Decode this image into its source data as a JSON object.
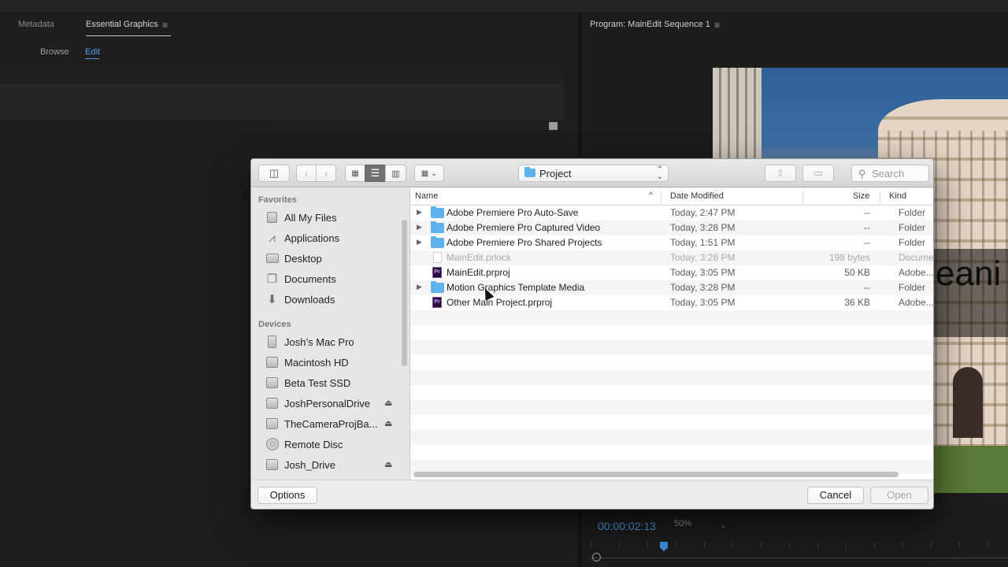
{
  "premiere": {
    "tabs": {
      "metadata": "Metadata",
      "essential_graphics": "Essential Graphics"
    },
    "subtabs": {
      "browse": "Browse",
      "edit": "Edit"
    },
    "program_title": "Program: MainEdit Sequence 1",
    "menu_icon": "≡",
    "timecode": "00:00:02:13",
    "zoom": "50%",
    "overlay_text": "eani"
  },
  "dialog": {
    "location": "Project",
    "search_placeholder": "Search",
    "sidebar": {
      "favorites_header": "Favorites",
      "favorites": [
        {
          "label": "All My Files",
          "icon": "all-files-icon"
        },
        {
          "label": "Applications",
          "icon": "applications-icon"
        },
        {
          "label": "Desktop",
          "icon": "desktop-icon"
        },
        {
          "label": "Documents",
          "icon": "documents-icon"
        },
        {
          "label": "Downloads",
          "icon": "downloads-icon"
        }
      ],
      "devices_header": "Devices",
      "devices": [
        {
          "label": "Josh’s Mac Pro",
          "icon": "computer-icon",
          "eject": false
        },
        {
          "label": "Macintosh HD",
          "icon": "disk-icon",
          "eject": false
        },
        {
          "label": "Beta Test SSD",
          "icon": "disk-icon",
          "eject": false
        },
        {
          "label": "JoshPersonalDrive",
          "icon": "disk-icon",
          "eject": true
        },
        {
          "label": "TheCameraProjBa...",
          "icon": "disk-icon",
          "eject": true
        },
        {
          "label": "Remote Disc",
          "icon": "disc-icon",
          "eject": false
        },
        {
          "label": "Josh_Drive",
          "icon": "disk-icon",
          "eject": true
        }
      ]
    },
    "columns": {
      "name": "Name",
      "date": "Date Modified",
      "size": "Size",
      "kind": "Kind"
    },
    "files": [
      {
        "name": "Adobe Premiere Pro Auto-Save",
        "date": "Today, 2:47 PM",
        "size": "--",
        "kind": "Folder",
        "type": "folder",
        "expandable": true
      },
      {
        "name": "Adobe Premiere Pro Captured Video",
        "date": "Today, 3:28 PM",
        "size": "--",
        "kind": "Folder",
        "type": "folder",
        "expandable": true
      },
      {
        "name": "Adobe Premiere Pro Shared Projects",
        "date": "Today, 1:51 PM",
        "size": "--",
        "kind": "Folder",
        "type": "folder",
        "expandable": true
      },
      {
        "name": "MainEdit.prlock",
        "date": "Today, 3:28 PM",
        "size": "198 bytes",
        "kind": "Document",
        "type": "lock",
        "expandable": false,
        "dimmed": true
      },
      {
        "name": "MainEdit.prproj",
        "date": "Today, 3:05 PM",
        "size": "50 KB",
        "kind": "Adobe...Pr",
        "type": "prproj",
        "expandable": false
      },
      {
        "name": "Motion Graphics Template Media",
        "date": "Today, 3:28 PM",
        "size": "--",
        "kind": "Folder",
        "type": "folder",
        "expandable": true
      },
      {
        "name": "Other Main Project.prproj",
        "date": "Today, 3:05 PM",
        "size": "36 KB",
        "kind": "Adobe...Pr",
        "type": "prproj",
        "expandable": false
      }
    ],
    "buttons": {
      "options": "Options",
      "cancel": "Cancel",
      "open": "Open"
    }
  },
  "colors": {
    "accent_blue": "#4e9fe6",
    "folder_blue": "#5eb3ec"
  }
}
